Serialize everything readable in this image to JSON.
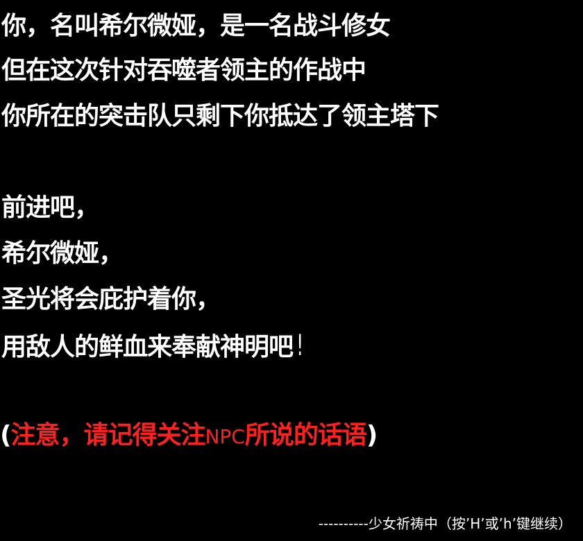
{
  "story": {
    "line1": "你，名叫希尔微娅，是一名战斗修女",
    "line2": "但在这次针对吞噬者领主的作战中",
    "line3": "你所在的突击队只剩下你抵达了领主塔下",
    "line4": "前进吧，",
    "line5": "希尔微娅，",
    "line6": "圣光将会庇护着你，",
    "line7": "用敌人的鲜血来奉献神明吧",
    "line7_mark": "!"
  },
  "notice": {
    "open": "(",
    "part1": "注意，请记得关注",
    "npc": "NPC",
    "part2": "所说的话语",
    "close": ")"
  },
  "footer": {
    "text": "----------少女祈祷中（按’H’或’h’键继续）"
  },
  "colors": {
    "background": "#000000",
    "text": "#ffffff",
    "notice": "#ff2020"
  }
}
